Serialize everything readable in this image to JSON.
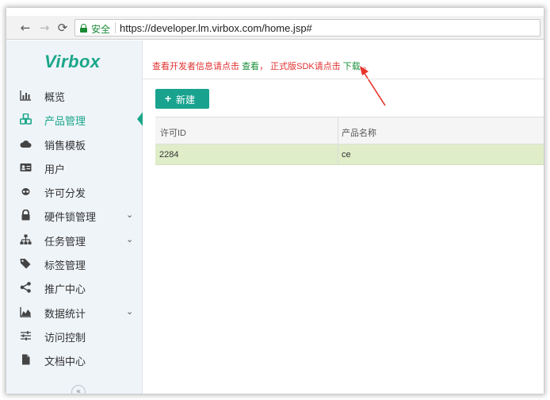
{
  "browser": {
    "secure_label": "安全",
    "url": "https://developer.lm.virbox.com/home.jsp#",
    "back_icon": "←",
    "forward_icon": "→",
    "reload_icon": "⟳"
  },
  "sidebar": {
    "logo": "Virbox",
    "items": [
      {
        "label": "概览",
        "icon": "bar-chart-icon"
      },
      {
        "label": "产品管理",
        "icon": "cubes-icon",
        "active": true
      },
      {
        "label": "销售模板",
        "icon": "cloud-icon"
      },
      {
        "label": "用户",
        "icon": "id-card-icon"
      },
      {
        "label": "许可分发",
        "icon": "link-icon"
      },
      {
        "label": "硬件锁管理",
        "icon": "lock-icon",
        "chevron": "⌄"
      },
      {
        "label": "任务管理",
        "icon": "sitemap-icon",
        "chevron": "⌄"
      },
      {
        "label": "标签管理",
        "icon": "tags-icon"
      },
      {
        "label": "推广中心",
        "icon": "share-icon"
      },
      {
        "label": "数据统计",
        "icon": "area-chart-icon",
        "chevron": "⌄"
      },
      {
        "label": "访问控制",
        "icon": "sliders-icon"
      },
      {
        "label": "文档中心",
        "icon": "file-icon"
      }
    ],
    "collapse_icon": "«"
  },
  "main": {
    "notice": {
      "prefix": "查看开发者信息请点击 ",
      "link1": "查看",
      "middle": "， 正式版SDK请点击 ",
      "link2": "下载",
      "suffix": " 。"
    },
    "new_button": {
      "icon": "+",
      "label": "新建"
    },
    "table": {
      "headers": [
        "许可ID",
        "产品名称"
      ],
      "rows": [
        [
          "2284",
          "ce"
        ]
      ]
    }
  },
  "colors": {
    "brand": "#1aa689",
    "notice_red": "#e0312f",
    "link_green": "#1b8f3a",
    "row_highlight": "#dfedc9"
  }
}
